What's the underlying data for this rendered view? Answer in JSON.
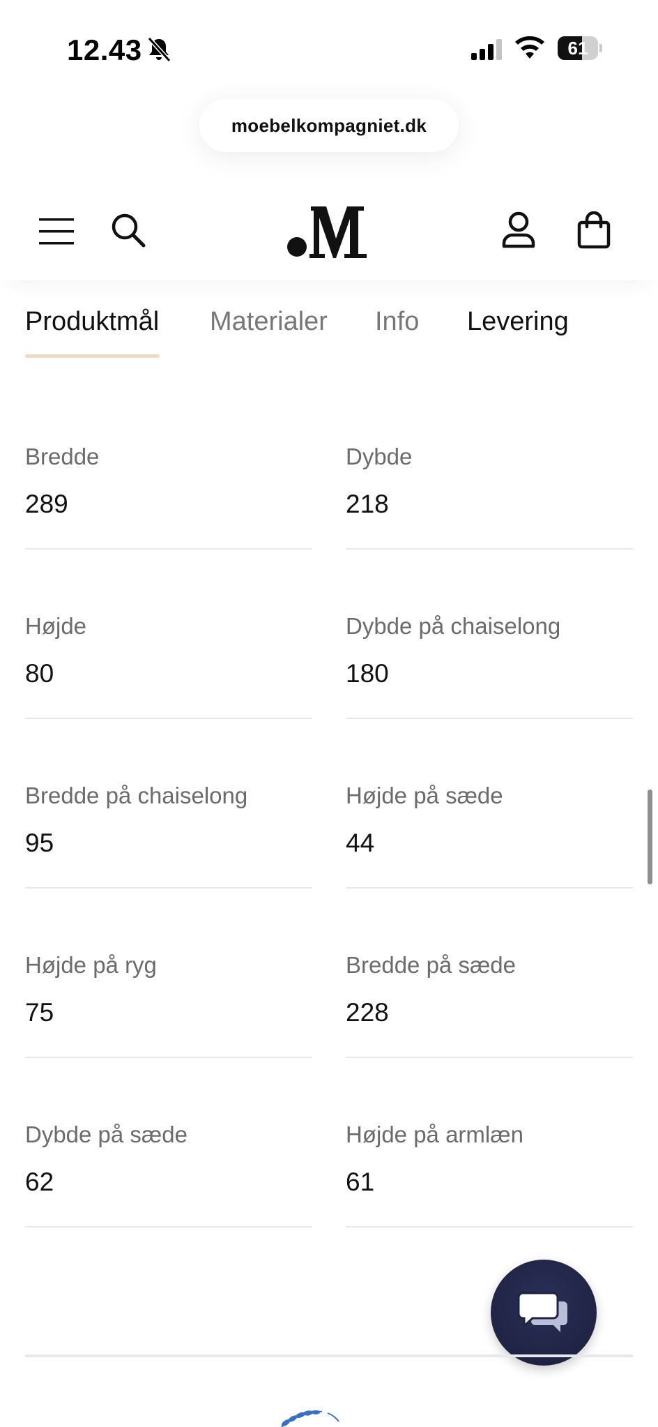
{
  "status_bar": {
    "time": "12.43",
    "battery_level": "61",
    "battery_fraction": 0.61
  },
  "browser": {
    "url": "moebelkompagniet.dk"
  },
  "header": {
    "logo_text": "M",
    "icons": [
      "menu-icon",
      "search-icon",
      "logo",
      "account-icon",
      "cart-icon"
    ]
  },
  "tabs": [
    {
      "label": "Produktmål",
      "active": true
    },
    {
      "label": "Materialer",
      "active": false
    },
    {
      "label": "Info",
      "active": false
    },
    {
      "label": "Levering",
      "active": false
    }
  ],
  "specs": [
    {
      "label": "Bredde",
      "value": "289"
    },
    {
      "label": "Dybde",
      "value": "218"
    },
    {
      "label": "Højde",
      "value": "80"
    },
    {
      "label": "Dybde på chaiselong",
      "value": "180"
    },
    {
      "label": "Bredde på chaiselong",
      "value": "95"
    },
    {
      "label": "Højde på sæde",
      "value": "44"
    },
    {
      "label": "Højde på ryg",
      "value": "75"
    },
    {
      "label": "Bredde på sæde",
      "value": "228"
    },
    {
      "label": "Dybde på sæde",
      "value": "62"
    },
    {
      "label": "Højde på armlæn",
      "value": "61"
    }
  ],
  "colors": {
    "accent_underline": "#ecdcc2",
    "chat_button": "#1f2344"
  }
}
